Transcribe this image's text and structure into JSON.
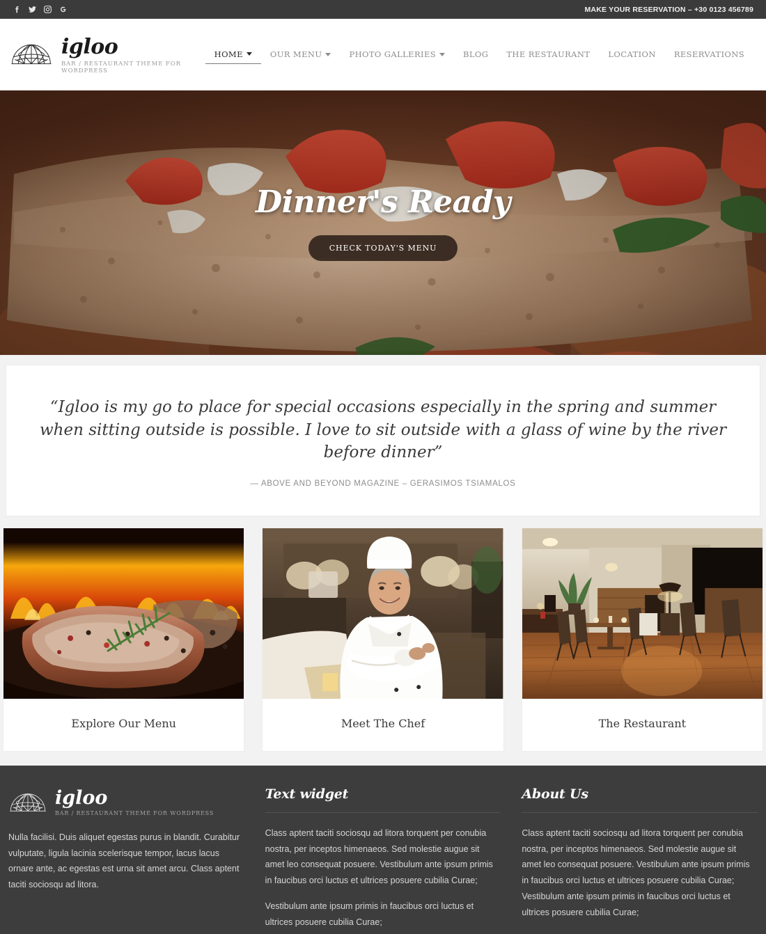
{
  "topbar": {
    "social": [
      {
        "name": "facebook-icon",
        "glyph": "f"
      },
      {
        "name": "twitter-icon",
        "glyph": "t"
      },
      {
        "name": "instagram-icon",
        "glyph": "i"
      },
      {
        "name": "google-plus-icon",
        "glyph": "G"
      }
    ],
    "reservation": "MAKE YOUR RESERVATION – +30 0123 456789",
    "background_color": "#3b3b3b"
  },
  "header": {
    "logo_icon": "geodesic-dome-icon",
    "brand_name": "igloo",
    "brand_tagline": "BAR / RESTAURANT THEME FOR WORDPRESS",
    "nav": [
      {
        "label": "HOME",
        "has_dropdown": true,
        "active": true
      },
      {
        "label": "OUR MENU",
        "has_dropdown": true,
        "active": false
      },
      {
        "label": "PHOTO GALLERIES",
        "has_dropdown": true,
        "active": false
      },
      {
        "label": "BLOG",
        "has_dropdown": false,
        "active": false
      },
      {
        "label": "THE RESTAURANT",
        "has_dropdown": false,
        "active": false
      },
      {
        "label": "LOCATION",
        "has_dropdown": false,
        "active": false
      },
      {
        "label": "RESERVATIONS",
        "has_dropdown": false,
        "active": false
      }
    ]
  },
  "hero": {
    "image_description": "Close-up of bruschetta — toasted crusty bread topped with diced tomato, onion and basil",
    "title": "Dinner's Ready",
    "button_label": "CHECK TODAY'S MENU"
  },
  "quote": {
    "text": "“Igloo is my go to place for special occasions especially in the spring and summer when sitting outside is possible. I love to sit outside with a glass of wine by the river before dinner”",
    "author": "— ABOVE AND BEYOND MAGAZINE – GERASIMOS TSIAMALOS"
  },
  "cards": [
    {
      "caption": "Explore Our Menu",
      "image_description": "Grilled steak with rosemary and peppercorns over open flames"
    },
    {
      "caption": "Meet The Chef",
      "image_description": "Smiling chef in white uniform and toque with arms crossed in a restaurant"
    },
    {
      "caption": "The Restaurant",
      "image_description": "Warmly lit restaurant interior with hardwood floor, dining table and chairs"
    }
  ],
  "footer": {
    "background_color": "#3d3d3d",
    "brand_name": "igloo",
    "brand_tagline": "BAR / RESTAURANT THEME FOR WORDPRESS",
    "column1_text": "Nulla facilisi. Duis aliquet egestas purus in blandit. Curabitur vulputate, ligula lacinia scelerisque tempor, lacus lacus ornare ante, ac egestas est urna sit amet arcu. Class aptent taciti sociosqu ad litora.",
    "column2": {
      "title": "Text widget",
      "paragraph1": "Class aptent taciti sociosqu ad litora torquent per conubia nostra, per inceptos himenaeos. Sed molestie augue sit amet leo consequat posuere. Vestibulum ante ipsum primis in faucibus orci luctus et ultrices posuere cubilia Curae;",
      "paragraph2": "Vestibulum ante ipsum primis in faucibus orci luctus et ultrices posuere cubilia Curae;"
    },
    "column3": {
      "title": "About Us",
      "paragraph1": "Class aptent taciti sociosqu ad litora torquent per conubia nostra, per inceptos himenaeos. Sed molestie augue sit amet leo consequat posuere. Vestibulum ante ipsum primis in faucibus orci luctus et ultrices posuere cubilia Curae; Vestibulum ante ipsum primis in faucibus orci luctus et ultrices posuere cubilia Curae;"
    }
  }
}
